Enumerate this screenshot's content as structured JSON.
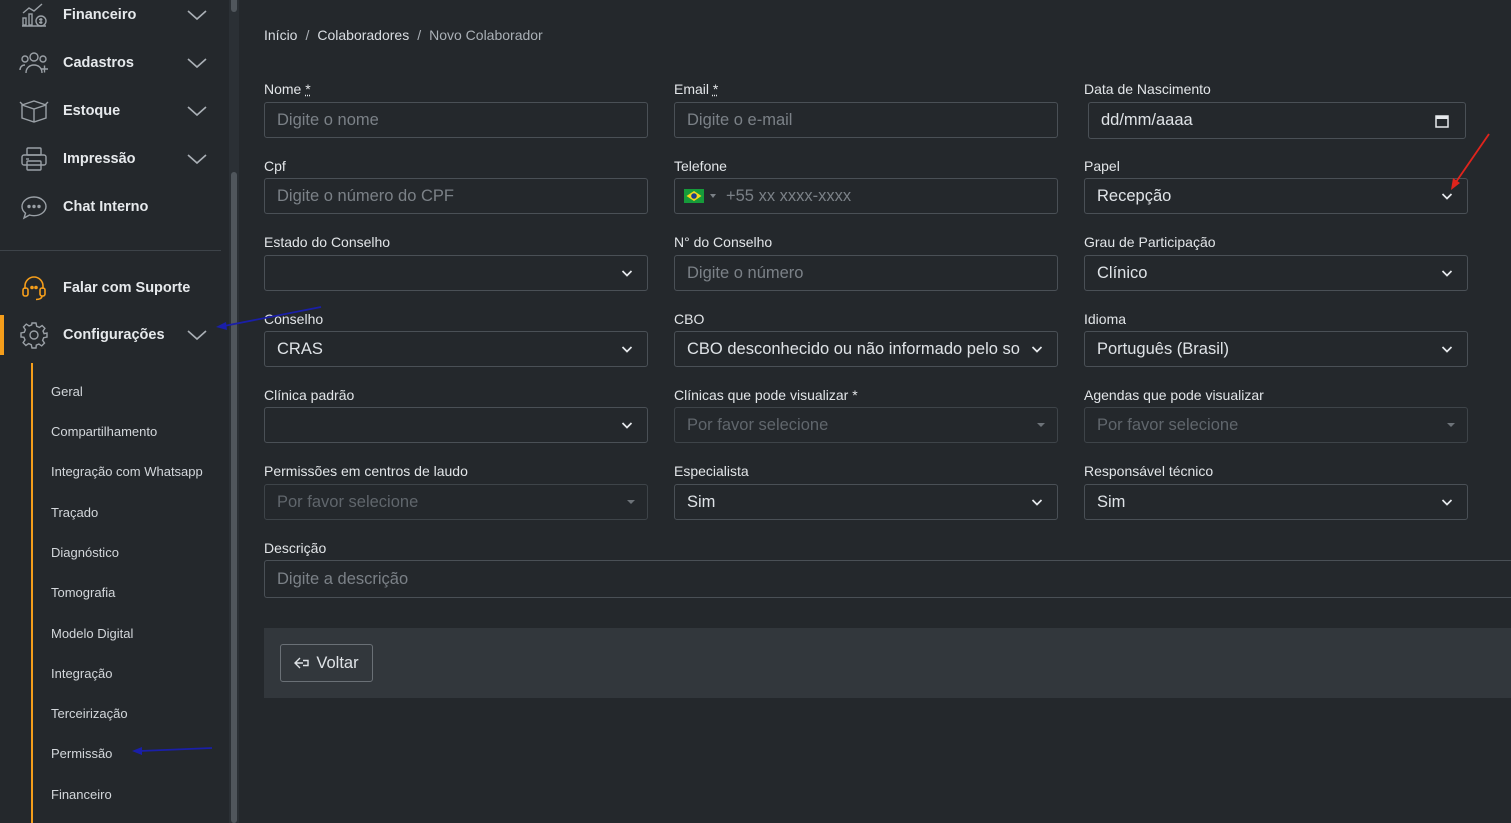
{
  "sidebar": {
    "items": [
      {
        "label": "Financeiro",
        "icon": "finance-icon"
      },
      {
        "label": "Cadastros",
        "icon": "users-icon"
      },
      {
        "label": "Estoque",
        "icon": "box-icon"
      },
      {
        "label": "Impressão",
        "icon": "printer-icon"
      },
      {
        "label": "Chat Interno",
        "icon": "chat-icon"
      }
    ],
    "support_label": "Falar com Suporte",
    "config_label": "Configurações",
    "submenu": [
      "Geral",
      "Compartilhamento",
      "Integração com Whatsapp",
      "Traçado",
      "Diagnóstico",
      "Tomografia",
      "Modelo Digital",
      "Integração",
      "Terceirização",
      "Permissão",
      "Financeiro"
    ]
  },
  "breadcrumb": {
    "home": "Início",
    "sep": "/",
    "section": "Colaboradores",
    "current": "Novo Colaborador"
  },
  "form": {
    "nome": {
      "label": "Nome",
      "req": "*",
      "placeholder": "Digite o nome"
    },
    "email": {
      "label": "Email",
      "req": "*",
      "placeholder": "Digite o e-mail"
    },
    "nascimento": {
      "label": "Data de Nascimento",
      "value": "dd/mm/aaaa"
    },
    "cpf": {
      "label": "Cpf",
      "placeholder": "Digite o número do CPF"
    },
    "telefone": {
      "label": "Telefone",
      "placeholder": "+55 xx xxxx-xxxx"
    },
    "papel": {
      "label": "Papel",
      "value": "Recepção"
    },
    "estado_conselho": {
      "label": "Estado do Conselho",
      "value": ""
    },
    "num_conselho": {
      "label": "N° do Conselho",
      "placeholder": "Digite o número"
    },
    "grau": {
      "label": "Grau de Participação",
      "value": "Clínico"
    },
    "conselho": {
      "label": "Conselho",
      "value": "CRAS"
    },
    "cbo": {
      "label": "CBO",
      "value": "CBO desconhecido ou não informado pelo so"
    },
    "idioma": {
      "label": "Idioma",
      "value": "Português (Brasil)"
    },
    "clinica_padrao": {
      "label": "Clínica padrão",
      "value": ""
    },
    "clinicas_visualizar": {
      "label": "Clínicas que pode visualizar *",
      "placeholder": "Por favor selecione"
    },
    "agendas_visualizar": {
      "label": "Agendas que pode visualizar",
      "placeholder": "Por favor selecione"
    },
    "permissoes_laudo": {
      "label": "Permissões em centros de laudo",
      "placeholder": "Por favor selecione"
    },
    "especialista": {
      "label": "Especialista",
      "value": "Sim"
    },
    "responsavel": {
      "label": "Responsável técnico",
      "value": "Sim"
    },
    "descricao": {
      "label": "Descrição",
      "placeholder": "Digite a descrição"
    }
  },
  "footer": {
    "back_label": "Voltar"
  },
  "colors": {
    "accent": "#f59e1b",
    "background": "#24282c",
    "annotation_red": "#e0241c",
    "annotation_blue": "#1a1fa8"
  }
}
